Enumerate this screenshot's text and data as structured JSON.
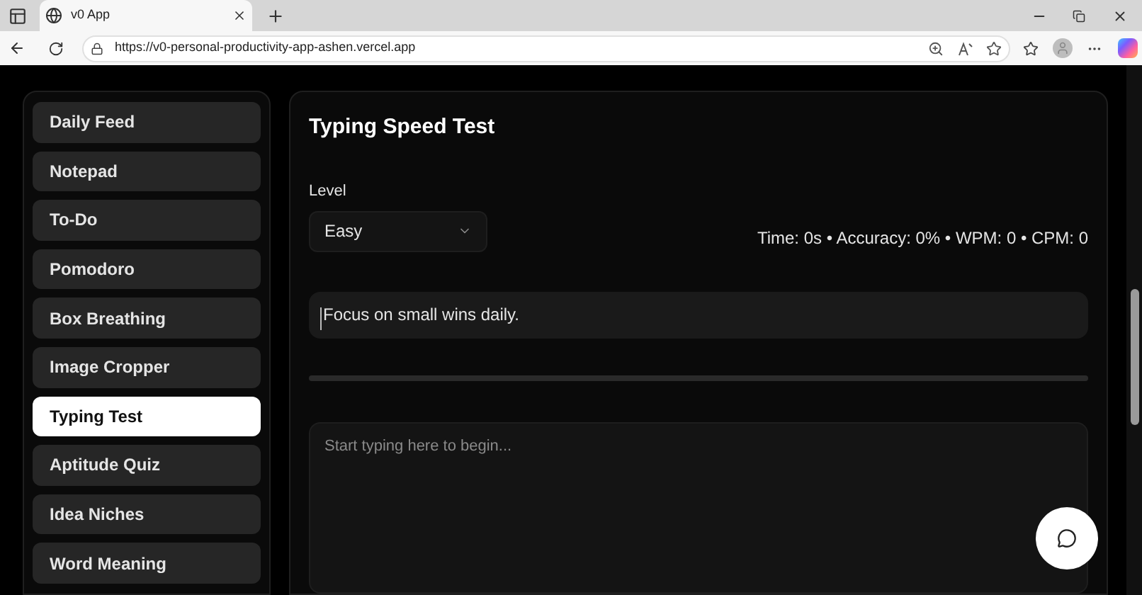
{
  "browser": {
    "tab_title": "v0 App",
    "url": "https://v0-personal-productivity-app-ashen.vercel.app"
  },
  "sidebar": {
    "items": [
      {
        "label": "Daily Feed",
        "selected": false
      },
      {
        "label": "Notepad",
        "selected": false
      },
      {
        "label": "To-Do",
        "selected": false
      },
      {
        "label": "Pomodoro",
        "selected": false
      },
      {
        "label": "Box Breathing",
        "selected": false
      },
      {
        "label": "Image Cropper",
        "selected": false
      },
      {
        "label": "Typing Test",
        "selected": true
      },
      {
        "label": "Aptitude Quiz",
        "selected": false
      },
      {
        "label": "Idea Niches",
        "selected": false
      },
      {
        "label": "Word Meaning",
        "selected": false
      }
    ]
  },
  "main": {
    "title": "Typing Speed Test",
    "level_label": "Level",
    "level_value": "Easy",
    "stats": "Time: 0s • Accuracy: 0% • WPM: 0 • CPM: 0",
    "prompt": "Focus on small wins daily.",
    "progress": {
      "level": 0
    },
    "input": {
      "placeholder": "Start typing here to begin..."
    }
  }
}
